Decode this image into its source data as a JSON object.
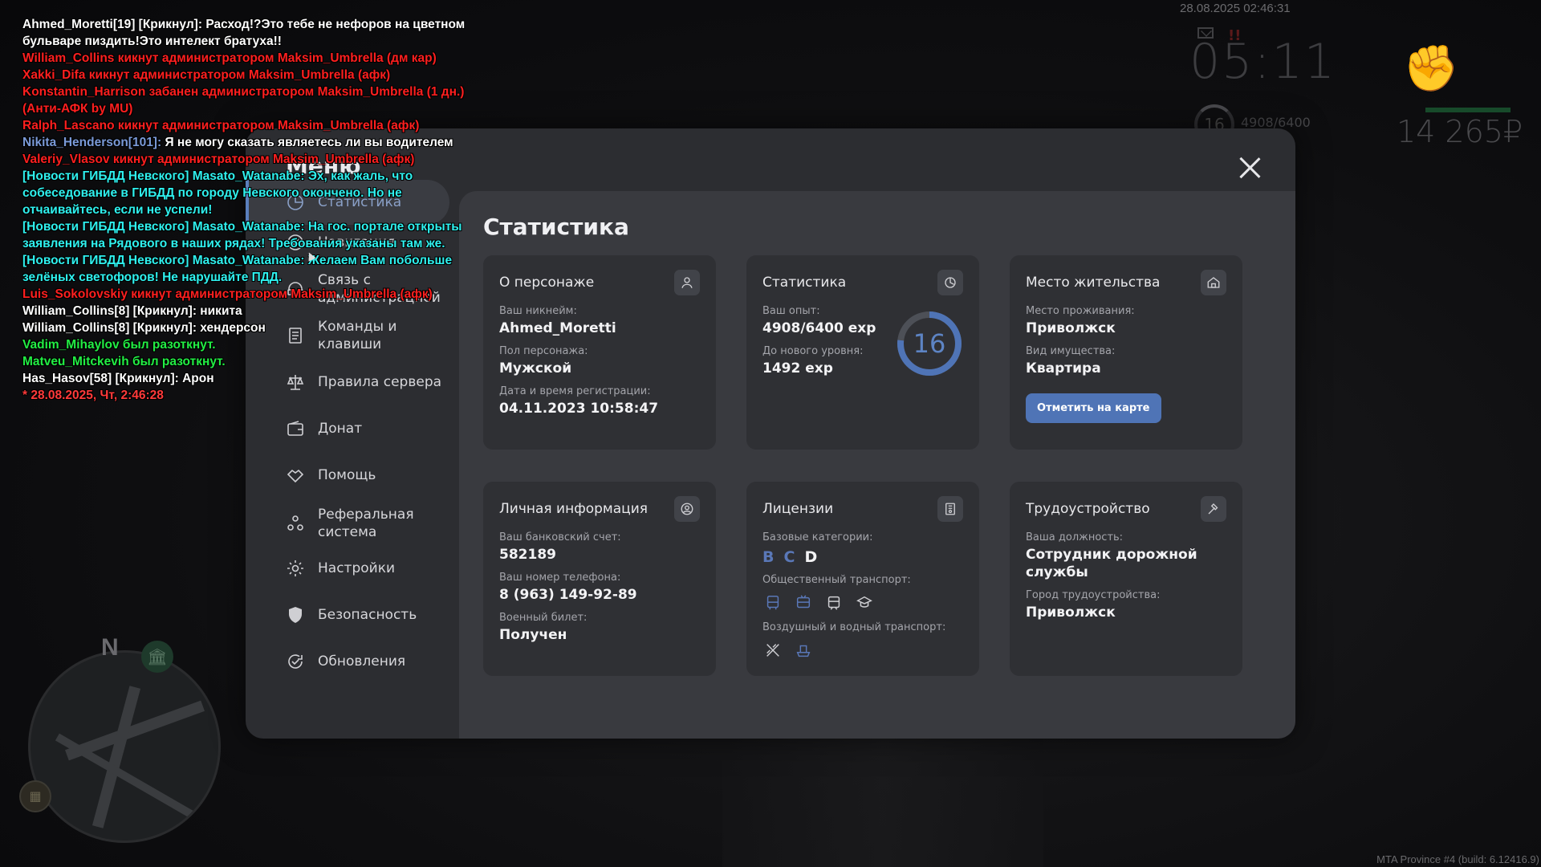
{
  "hud": {
    "datetime": "28.08.2025 02:46:31",
    "clock": "05:11",
    "alert": "!!",
    "level": "16",
    "exp": "4908/6400",
    "money": "14 265₽"
  },
  "minimap": {
    "north": "N"
  },
  "build": "MTA Province #4 (build: 6.12416.9)",
  "chat": [
    {
      "segments": [
        {
          "text": "Ahmed_Moretti[19] [Крикнул]: Расход!?Это тебе не нефоров на цветном бульваре пиздить!Это интелект братуха!!",
          "color": "white"
        }
      ]
    },
    {
      "segments": [
        {
          "text": "William_Collins кикнут администратором Maksim_Umbrella (дм кар)",
          "color": "red"
        }
      ]
    },
    {
      "segments": [
        {
          "text": "Xakki_Difa кикнут администратором Maksim_Umbrella (афк)",
          "color": "red"
        }
      ]
    },
    {
      "segments": [
        {
          "text": "Konstantin_Harrison забанен администратором Maksim_Umbrella (1 дн.) (Анти-АФК by MU)",
          "color": "red"
        }
      ]
    },
    {
      "segments": [
        {
          "text": "Ralph_Lascano кикнут администратором Maksim_Umbrella (афк)",
          "color": "red"
        }
      ]
    },
    {
      "segments": [
        {
          "text": "Nikita_Henderson[101]: ",
          "color": "blue"
        },
        {
          "text": "Я не могу сказать являетесь ли вы водителем",
          "color": "white"
        }
      ]
    },
    {
      "segments": [
        {
          "text": "Valeriy_Vlasov кикнут администратором Maksim_Umbrella (афк)",
          "color": "red"
        }
      ]
    },
    {
      "segments": [
        {
          "text": "[Новости ГИБДД Невского] Masato_Watanabe: Эх, как жаль, что собеседование в ГИБДД по городу Невского окончено. Но не отчаивайтесь, если не успели!",
          "color": "cyan"
        }
      ]
    },
    {
      "segments": [
        {
          "text": "[Новости ГИБДД Невского] Masato_Watanabe: На гос. портале открыты заявления на Рядового в наших рядах! Требования указаны там же.",
          "color": "cyan"
        }
      ]
    },
    {
      "segments": [
        {
          "text": "[Новости ГИБДД Невского] Masato_Watanabe: Желаем Вам побольше зелёных светофоров! Не нарушайте ПДД.",
          "color": "cyan"
        }
      ]
    },
    {
      "segments": [
        {
          "text": "Luis_Sokolovskiy кикнут администратором Maksim_Umbrella (афк)",
          "color": "red"
        }
      ]
    },
    {
      "segments": [
        {
          "text": "William_Collins[8] [Крикнул]: никита",
          "color": "white"
        }
      ]
    },
    {
      "segments": [
        {
          "text": "William_Collins[8] [Крикнул]: хендерсон",
          "color": "white"
        }
      ]
    },
    {
      "segments": [
        {
          "text": "Vadim_Mihaylov был разоткнут.",
          "color": "green"
        }
      ]
    },
    {
      "segments": [
        {
          "text": "Matveu_Mitckevih был разоткнут.",
          "color": "green"
        }
      ]
    },
    {
      "segments": [
        {
          "text": "Has_Hasov[58] [Крикнул]: Арон",
          "color": "white"
        }
      ]
    },
    {
      "segments": [
        {
          "text": "* 28.08.2025, Чт, 2:46:28",
          "color": "red2"
        }
      ]
    }
  ],
  "menu": {
    "title": "Меню",
    "sidebar": [
      {
        "label": "Статистика",
        "icon": "chart-icon",
        "active": true
      },
      {
        "label": "Навигация",
        "icon": "compass-icon"
      },
      {
        "label": "Связь с администрацией",
        "icon": "headset-icon"
      },
      {
        "label": "Команды и клавиши",
        "icon": "document-icon"
      },
      {
        "label": "Правила сервера",
        "icon": "scales-icon"
      },
      {
        "label": "Донат",
        "icon": "wallet-icon"
      },
      {
        "label": "Помощь",
        "icon": "handshake-icon"
      },
      {
        "label": "Реферальная система",
        "icon": "people-icon"
      },
      {
        "label": "Настройки",
        "icon": "gear-icon"
      },
      {
        "label": "Безопасность",
        "icon": "shield-icon"
      },
      {
        "label": "Обновления",
        "icon": "refresh-check-icon"
      }
    ],
    "content_title": "Статистика",
    "cards": {
      "character": {
        "title": "О персонаже",
        "icon": "person-icon",
        "nickname_label": "Ваш никнейм:",
        "nickname": "Ahmed_Moretti",
        "gender_label": "Пол персонажа:",
        "gender": "Мужской",
        "reg_label": "Дата и время регистрации:",
        "reg": "04.11.2023 10:58:47"
      },
      "stats": {
        "title": "Статистика",
        "icon": "pie-clock-icon",
        "exp_label": "Ваш опыт:",
        "exp": "4908/6400 exp",
        "next_label": "До нового уровня:",
        "next": "1492 exp",
        "level": "16",
        "progress": 0.767
      },
      "residence": {
        "title": "Место жительства",
        "icon": "house-icon",
        "place_label": "Место проживания:",
        "place": "Приволжск",
        "type_label": "Вид имущества:",
        "type": "Квартира",
        "button": "Отметить на карте"
      },
      "personal": {
        "title": "Личная информация",
        "icon": "user-circle-icon",
        "bank_label": "Ваш банковский счет:",
        "bank": "582189",
        "phone_label": "Ваш номер телефона:",
        "phone": "8 (963) 149-92-89",
        "military_label": "Военный билет:",
        "military": "Получен"
      },
      "licenses": {
        "title": "Лицензии",
        "icon": "license-icon",
        "base_label": "Базовые категории:",
        "cat_b": "B",
        "cat_c": "C",
        "cat_d": "D",
        "public_label": "Общественный транспорт:",
        "air_label": "Воздушный и водный транспорт:"
      },
      "employment": {
        "title": "Трудоустройство",
        "icon": "hammer-icon",
        "position_label": "Ваша должность:",
        "position": "Сотрудник дорожной службы",
        "city_label": "Город трудоустройства:",
        "city": "Приволжск"
      }
    }
  },
  "colors": {
    "accent": "#5a7fbd",
    "panel": "#2c2d31",
    "content": "#393a3f",
    "card": "#2f3034",
    "chat_red": "#ff1f1f",
    "chat_cyan": "#2ff0ee",
    "chat_green": "#22ee44"
  }
}
